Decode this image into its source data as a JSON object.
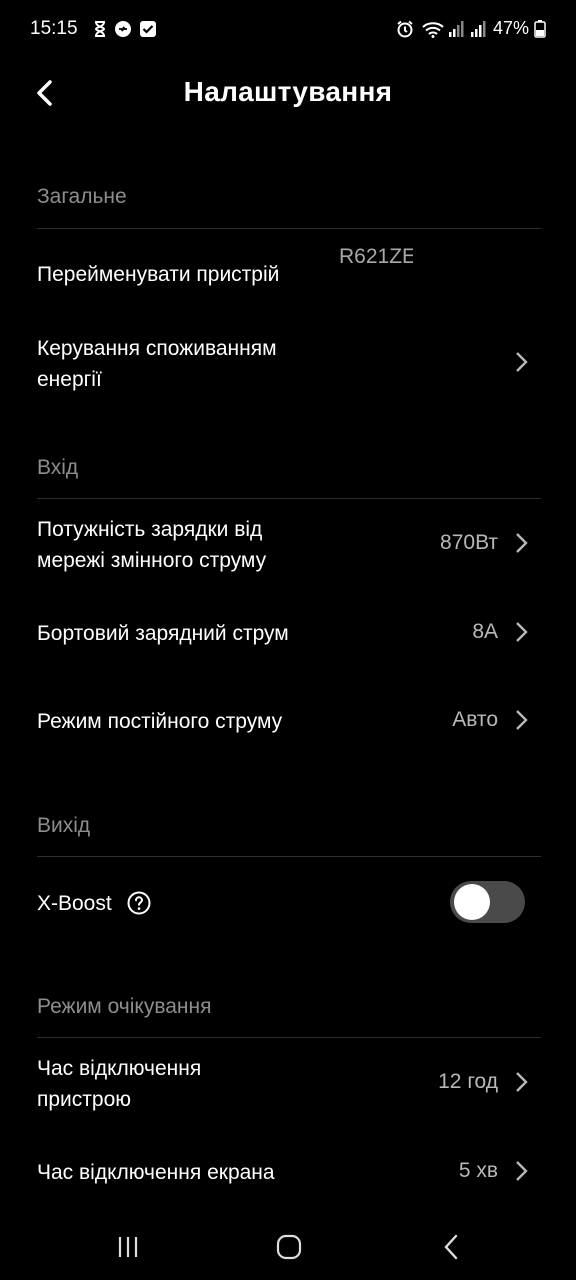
{
  "status_bar": {
    "time": "15:15",
    "battery": "47%",
    "icons": [
      "hourglass-icon",
      "sync-icon",
      "checkbox-icon",
      "alarm-icon",
      "wifi-icon",
      "signal-icon",
      "signal-icon",
      "battery-icon"
    ]
  },
  "header": {
    "title": "Налаштування",
    "back_icon": "back-arrow-icon"
  },
  "sections": {
    "general": {
      "title": "Загальне",
      "rename": {
        "label": "Перейменувати пристрій",
        "value": "R621ZE"
      },
      "energy": {
        "label_line1": "Керування споживанням",
        "label_line2": "енергії"
      }
    },
    "input": {
      "title": "Вхід",
      "ac_power": {
        "label_line1": "Потужність зарядки від",
        "label_line2": "мережі змінного струму",
        "value": "870Вт"
      },
      "onboard_current": {
        "label": "Бортовий зарядний струм",
        "value": "8A"
      },
      "dc_mode": {
        "label": "Режим постійного струму",
        "value": "Авто"
      }
    },
    "output": {
      "title": "Вихід",
      "xboost": {
        "label": "X-Boost",
        "enabled": false
      }
    },
    "standby": {
      "title": "Режим очікування",
      "device_off": {
        "label_line1": "Час відключення",
        "label_line2": "пристрою",
        "value": "12 год"
      },
      "screen_off": {
        "label": "Час відключення екрана",
        "value": "5 хв"
      }
    }
  },
  "nav_bar": {
    "icons": [
      "recent-apps-icon",
      "home-icon",
      "back-icon"
    ]
  }
}
